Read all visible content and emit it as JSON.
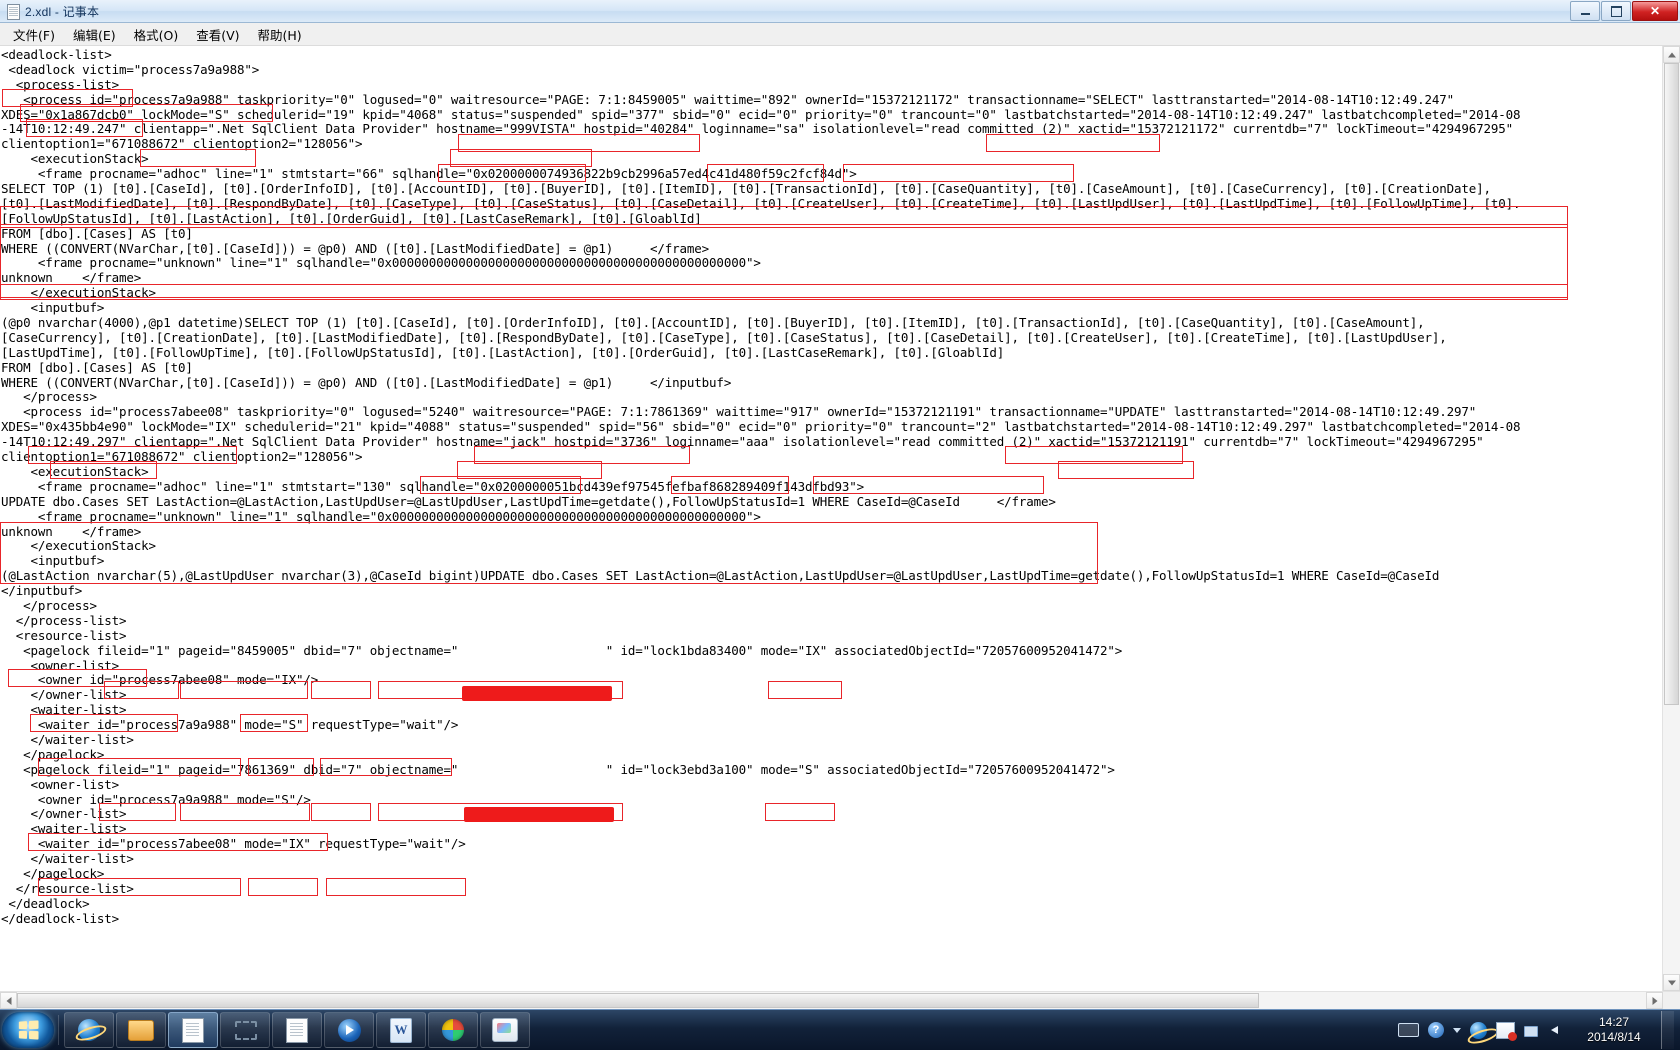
{
  "window": {
    "title": "2.xdl - 记事本",
    "icon": "notepad-document-icon",
    "minimize_label": "最小化",
    "maximize_label": "最大化",
    "close_label": "关闭"
  },
  "menu": {
    "items": [
      {
        "label": "文件(F)",
        "name": "menu-file"
      },
      {
        "label": "编辑(E)",
        "name": "menu-edit"
      },
      {
        "label": "格式(O)",
        "name": "menu-format"
      },
      {
        "label": "查看(V)",
        "name": "menu-view"
      },
      {
        "label": "帮助(H)",
        "name": "menu-help"
      }
    ]
  },
  "editor": {
    "text": "<deadlock-list>\n <deadlock victim=\"process7a9a988\">\n  <process-list>\n   <process id=\"process7a9a988\" taskpriority=\"0\" logused=\"0\" waitresource=\"PAGE: 7:1:8459005\" waittime=\"892\" ownerId=\"15372121172\" transactionname=\"SELECT\" lasttranstarted=\"2014-08-14T10:12:49.247\"\nXDES=\"0x1a867dcb0\" lockMode=\"S\" schedulerid=\"19\" kpid=\"4068\" status=\"suspended\" spid=\"377\" sbid=\"0\" ecid=\"0\" priority=\"0\" trancount=\"0\" lastbatchstarted=\"2014-08-14T10:12:49.247\" lastbatchcompleted=\"2014-08\n-14T10:12:49.247\" clientapp=\".Net SqlClient Data Provider\" hostname=\"999VISTA\" hostpid=\"40284\" loginname=\"sa\" isolationlevel=\"read committed (2)\" xactid=\"15372121172\" currentdb=\"7\" lockTimeout=\"4294967295\"\nclientoption1=\"671088672\" clientoption2=\"128056\">\n    <executionStack>\n     <frame procname=\"adhoc\" line=\"1\" stmtstart=\"66\" sqlhandle=\"0x0200000074936822b9cb2996a57ed4c41d480f59c2fcf84d\">\nSELECT TOP (1) [t0].[CaseId], [t0].[OrderInfoID], [t0].[AccountID], [t0].[BuyerID], [t0].[ItemID], [t0].[TransactionId], [t0].[CaseQuantity], [t0].[CaseAmount], [t0].[CaseCurrency], [t0].[CreationDate],\n[t0].[LastModifiedDate], [t0].[RespondByDate], [t0].[CaseType], [t0].[CaseStatus], [t0].[CaseDetail], [t0].[CreateUser], [t0].[CreateTime], [t0].[LastUpdUser], [t0].[LastUpdTime], [t0].[FollowUpTime], [t0].\n[FollowUpStatusId], [t0].[LastAction], [t0].[OrderGuid], [t0].[LastCaseRemark], [t0].[GloablId]\nFROM [dbo].[Cases] AS [t0]\nWHERE ((CONVERT(NVarChar,[t0].[CaseId])) = @p0) AND ([t0].[LastModifiedDate] = @p1)     </frame>\n     <frame procname=\"unknown\" line=\"1\" sqlhandle=\"0x000000000000000000000000000000000000000000000000\">\nunknown    </frame>\n    </executionStack>\n    <inputbuf>\n(@p0 nvarchar(4000),@p1 datetime)SELECT TOP (1) [t0].[CaseId], [t0].[OrderInfoID], [t0].[AccountID], [t0].[BuyerID], [t0].[ItemID], [t0].[TransactionId], [t0].[CaseQuantity], [t0].[CaseAmount],\n[CaseCurrency], [t0].[CreationDate], [t0].[LastModifiedDate], [t0].[RespondByDate], [t0].[CaseType], [t0].[CaseStatus], [t0].[CaseDetail], [t0].[CreateUser], [t0].[CreateTime], [t0].[LastUpdUser],\n[LastUpdTime], [t0].[FollowUpTime], [t0].[FollowUpStatusId], [t0].[LastAction], [t0].[OrderGuid], [t0].[LastCaseRemark], [t0].[GloablId]\nFROM [dbo].[Cases] AS [t0]\nWHERE ((CONVERT(NVarChar,[t0].[CaseId])) = @p0) AND ([t0].[LastModifiedDate] = @p1)     </inputbuf>\n   </process>\n   <process id=\"process7abee08\" taskpriority=\"0\" logused=\"5240\" waitresource=\"PAGE: 7:1:7861369\" waittime=\"917\" ownerId=\"15372121191\" transactionname=\"UPDATE\" lasttranstarted=\"2014-08-14T10:12:49.297\"\nXDES=\"0x435bb4e90\" lockMode=\"IX\" schedulerid=\"21\" kpid=\"4088\" status=\"suspended\" spid=\"56\" sbid=\"0\" ecid=\"0\" priority=\"0\" trancount=\"2\" lastbatchstarted=\"2014-08-14T10:12:49.297\" lastbatchcompleted=\"2014-08\n-14T10:12:49.297\" clientapp=\".Net SqlClient Data Provider\" hostname=\"jack\" hostpid=\"3736\" loginname=\"aaa\" isolationlevel=\"read committed (2)\" xactid=\"15372121191\" currentdb=\"7\" lockTimeout=\"4294967295\"\nclientoption1=\"671088672\" clientoption2=\"128056\">\n    <executionStack>\n     <frame procname=\"adhoc\" line=\"1\" stmtstart=\"130\" sqlhandle=\"0x0200000051bcd439ef97545fefbaf868289409f143dfbd93\">\nUPDATE dbo.Cases SET LastAction=@LastAction,LastUpdUser=@LastUpdUser,LastUpdTime=getdate(),FollowUpStatusId=1 WHERE CaseId=@CaseId     </frame>\n     <frame procname=\"unknown\" line=\"1\" sqlhandle=\"0x000000000000000000000000000000000000000000000000\">\nunknown    </frame>\n    </executionStack>\n    <inputbuf>\n(@LastAction nvarchar(5),@LastUpdUser nvarchar(3),@CaseId bigint)UPDATE dbo.Cases SET LastAction=@LastAction,LastUpdUser=@LastUpdUser,LastUpdTime=getdate(),FollowUpStatusId=1 WHERE CaseId=@CaseId\n</inputbuf>\n   </process>\n  </process-list>\n  <resource-list>\n   <pagelock fileid=\"1\" pageid=\"8459005\" dbid=\"7\" objectname=\"                    \" id=\"lock1bda83400\" mode=\"IX\" associatedObjectId=\"72057600952041472\">\n    <owner-list>\n     <owner id=\"process7abee08\" mode=\"IX\"/>\n    </owner-list>\n    <waiter-list>\n     <waiter id=\"process7a9a988\" mode=\"S\" requestType=\"wait\"/>\n    </waiter-list>\n   </pagelock>\n   <pagelock fileid=\"1\" pageid=\"7861369\" dbid=\"7\" objectname=\"                    \" id=\"lock3ebd3a100\" mode=\"S\" associatedObjectId=\"72057600952041472\">\n    <owner-list>\n     <owner id=\"process7a9a988\" mode=\"S\"/>\n    </owner-list>\n    <waiter-list>\n     <waiter id=\"process7abee08\" mode=\"IX\" requestType=\"wait\"/>\n    </waiter-list>\n   </pagelock>\n  </resource-list>\n </deadlock>\n</deadlock-list>",
    "annotation_color": "#e8252a",
    "redaction_color": "#ee1b1b",
    "highlighted_tokens": [
      "<deadlock-list>",
      "<deadlock victim=\"process7a9a988\">",
      "<process-list>",
      "waitresource=\"PAGE: 7:1:8459005\"",
      "transactionname=\"SELECT\"",
      "lockMode=\"S\"",
      "status=\"suspended\"",
      "hostname=\"999VISTA\"",
      "loginname=\"sa\"",
      "isolationlevel=\"read committed (2)\"",
      "process id=\"process7abee08\"",
      "waitresource=\"PAGE: 7:1:7861369\"",
      "transactionname=\"UPDATE\"",
      "lockMode=\"IX\"",
      "status=\"suspended\"",
      "trancount=\"2\"",
      "hostname=\"jack\"",
      "loginname=\"aaa\"",
      "isolationlevel=\"read committed (2)\"",
      "<resource-list>",
      "fileid=\"1\"",
      "pageid=\"8459005\"",
      "dbid=\"7\"",
      "objectname",
      "mode=\"IX\"",
      "owner id=\"process7abee08\"",
      "mode=\"IX\"",
      "waiter id=\"process7a9a988\"",
      "mode=\"S\"",
      "requestType=\"wait\"",
      "pageid=\"7861369\"",
      "mode=\"S\"",
      "owner id=\"process7a9a988\" mode=\"S\"",
      "waiter id=\"process7abee08\"",
      "mode=\"IX\"",
      "requestType=\"wait\""
    ]
  },
  "scrollbars": {
    "vertical_up": "▲",
    "vertical_down": "▼",
    "horizontal_left": "◀",
    "horizontal_right": "▶"
  },
  "taskbar": {
    "start_label": "开始",
    "buttons": [
      {
        "name": "taskbar-ie",
        "icon": "internet-explorer-icon",
        "active": false
      },
      {
        "name": "taskbar-explorer",
        "icon": "folder-icon",
        "active": false
      },
      {
        "name": "taskbar-notepad",
        "icon": "notepad-icon",
        "active": true
      },
      {
        "name": "taskbar-snipping-tool",
        "icon": "snipping-tool-icon",
        "active": false
      },
      {
        "name": "taskbar-document",
        "icon": "document-icon",
        "active": false
      },
      {
        "name": "taskbar-media-player",
        "icon": "media-player-icon",
        "active": false
      },
      {
        "name": "taskbar-word",
        "icon": "word-icon",
        "active": false
      },
      {
        "name": "taskbar-chrome",
        "icon": "browser-ball-icon",
        "active": false
      },
      {
        "name": "taskbar-paint",
        "icon": "paint-icon",
        "active": false
      }
    ],
    "tray": [
      {
        "name": "tray-keyboard-icon",
        "icon": "keyboard-icon"
      },
      {
        "name": "tray-help-icon",
        "icon": "help-icon",
        "glyph": "?"
      },
      {
        "name": "tray-show-hidden-icon",
        "icon": "chevron-up-icon"
      },
      {
        "name": "tray-ie-icon",
        "icon": "internet-explorer-icon"
      },
      {
        "name": "tray-action-center-icon",
        "icon": "flag-alert-icon"
      },
      {
        "name": "tray-network-icon",
        "icon": "network-icon"
      },
      {
        "name": "tray-volume-icon",
        "icon": "speaker-icon"
      }
    ],
    "clock": {
      "time": "14:27",
      "date": "2014/8/14"
    }
  }
}
